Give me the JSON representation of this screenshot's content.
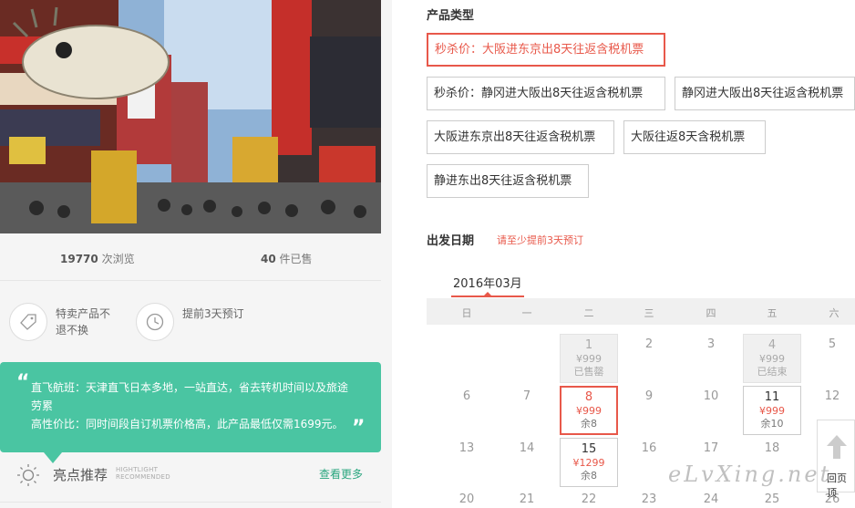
{
  "stats": {
    "views_count": "19770",
    "views_label": "次浏览",
    "sold_count": "40",
    "sold_label": "件已售"
  },
  "features": [
    {
      "icon": "tag-icon",
      "text": "特卖产品不退不换"
    },
    {
      "icon": "clock-icon",
      "text": "提前3天预订"
    }
  ],
  "highlight": {
    "quote_open": "“",
    "quote_close": "”",
    "line1": "直飞航班：天津直飞日本多地，一站直达，省去转机时间以及旅途劳累",
    "line2": "高性价比：同时间段自订机票价格高，此产品最低仅需1699元。",
    "title": "亮点推荐",
    "sub1": "HIGHTLIGHT",
    "sub2": "RECOMMENDED",
    "more": "查看更多"
  },
  "product_type": {
    "label": "产品类型",
    "options": [
      {
        "label": "秒杀价：大阪进东京出8天往返含税机票",
        "selected": true
      },
      {
        "label": "秒杀价：静冈进大阪出8天往返含税机票",
        "selected": false
      },
      {
        "label": "静冈进大阪出8天往返含税机票",
        "selected": false
      },
      {
        "label": "大阪进东京出8天往返含税机票",
        "selected": false
      },
      {
        "label": "大阪往返8天含税机票",
        "selected": false
      },
      {
        "label": "静进东出8天往返含税机票",
        "selected": false
      }
    ]
  },
  "departure": {
    "label": "出发日期",
    "note": "请至少提前3天预订",
    "month": "2016年03月",
    "weekdays": [
      "日",
      "一",
      "二",
      "三",
      "四",
      "五",
      "六"
    ],
    "days": {
      "d1": {
        "num": "1",
        "price": "¥999",
        "status": "已售罄"
      },
      "d2": {
        "num": "2"
      },
      "d3": {
        "num": "3"
      },
      "d4": {
        "num": "4",
        "price": "¥999",
        "status": "已结束"
      },
      "d5": {
        "num": "5"
      },
      "d6": {
        "num": "6"
      },
      "d7": {
        "num": "7"
      },
      "d8": {
        "num": "8",
        "price": "¥999",
        "status": "余8"
      },
      "d9": {
        "num": "9"
      },
      "d10": {
        "num": "10"
      },
      "d11": {
        "num": "11",
        "price": "¥999",
        "status": "余10"
      },
      "d12": {
        "num": "12"
      },
      "d13": {
        "num": "13"
      },
      "d14": {
        "num": "14"
      },
      "d15": {
        "num": "15",
        "price": "¥1299",
        "status": "余8"
      },
      "d16": {
        "num": "16"
      },
      "d17": {
        "num": "17"
      },
      "d18": {
        "num": "18"
      },
      "d20": {
        "num": "20"
      },
      "d21": {
        "num": "21"
      },
      "d22": {
        "num": "22"
      },
      "d23": {
        "num": "23"
      },
      "d24": {
        "num": "24"
      },
      "d25": {
        "num": "25"
      },
      "d26": {
        "num": "26"
      }
    }
  },
  "back_to_top": "回页顶",
  "watermark": "eLvXing.net",
  "colors": {
    "accent": "#e8584a",
    "teal": "#4ac5a2",
    "link": "#2aa67f"
  }
}
